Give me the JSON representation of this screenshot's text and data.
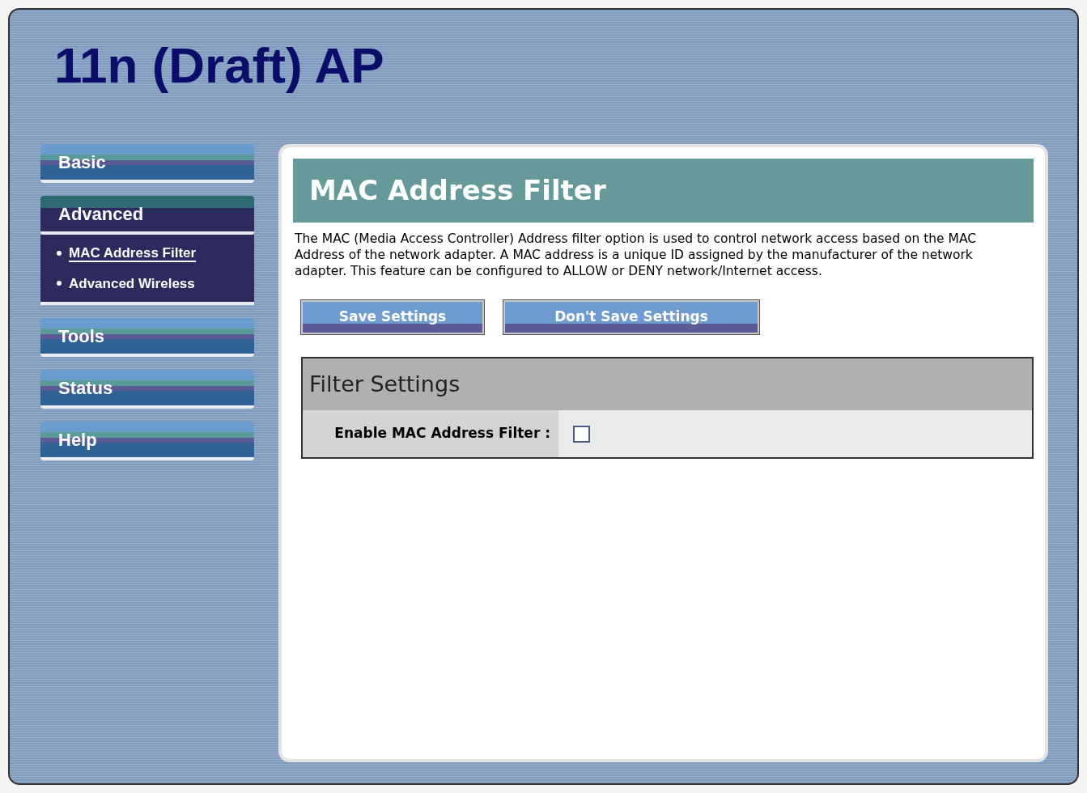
{
  "header": {
    "title": "11n (Draft) AP"
  },
  "nav": [
    {
      "label": "Basic",
      "expanded": false
    },
    {
      "label": "Advanced",
      "expanded": true,
      "children": [
        {
          "label": "MAC Address Filter",
          "selected": true
        },
        {
          "label": "Advanced Wireless",
          "selected": false
        }
      ]
    },
    {
      "label": "Tools",
      "expanded": false
    },
    {
      "label": "Status",
      "expanded": false
    },
    {
      "label": "Help",
      "expanded": false
    }
  ],
  "page": {
    "title": "MAC Address Filter",
    "description": "The MAC (Media Access Controller) Address filter option is used to control network access based on the MAC Address of the network adapter. A MAC address is a unique ID assigned by the manufacturer of the network adapter. This feature can be configured to ALLOW or DENY network/Internet access.",
    "buttons": [
      "Save Settings",
      "Don't Save Settings"
    ],
    "section": {
      "title": "Filter Settings",
      "fields": [
        {
          "label": "Enable MAC Address Filter :",
          "checked": false
        }
      ]
    }
  }
}
